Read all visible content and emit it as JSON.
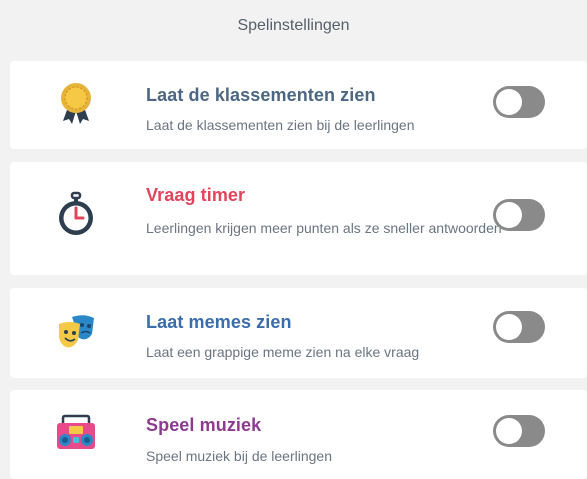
{
  "header": {
    "title": "Spelinstellingen"
  },
  "settings": [
    {
      "title": "Laat de klassementen zien",
      "description": "Laat de klassementen zien bij de leerlingen",
      "title_color": "#4c6783",
      "icon": "medal-icon",
      "enabled": false
    },
    {
      "title": "Vraag timer",
      "description": "Leerlingen krijgen meer punten als ze sneller antwoorden",
      "title_color": "#e2445c",
      "icon": "stopwatch-icon",
      "enabled": false
    },
    {
      "title": "Laat memes zien",
      "description": "Laat een grappige meme zien na elke vraag",
      "title_color": "#3b6dab",
      "icon": "theater-masks-icon",
      "enabled": false
    },
    {
      "title": "Speel muziek",
      "description": "Speel muziek bij de leerlingen",
      "title_color": "#8c3b91",
      "icon": "boombox-icon",
      "enabled": false
    }
  ]
}
